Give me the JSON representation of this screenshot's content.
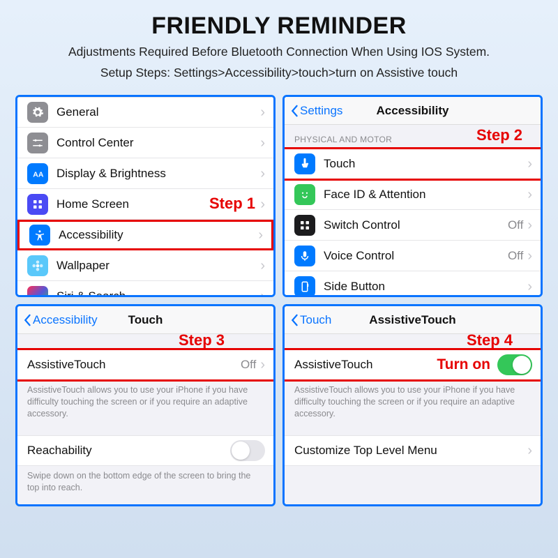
{
  "header": {
    "title": "FRIENDLY REMINDER",
    "line1": "Adjustments Required Before Bluetooth Connection When Using IOS System.",
    "line2": "Setup Steps: Settings>Accessibility>touch>turn on Assistive touch"
  },
  "steps": {
    "s1": "Step 1",
    "s2": "Step 2",
    "s3": "Step 3",
    "s4": "Step 4",
    "turnon": "Turn on"
  },
  "panel1": {
    "rows": [
      {
        "label": "General"
      },
      {
        "label": "Control Center"
      },
      {
        "label": "Display & Brightness"
      },
      {
        "label": "Home Screen"
      },
      {
        "label": "Accessibility"
      },
      {
        "label": "Wallpaper"
      },
      {
        "label": "Siri & Search"
      }
    ]
  },
  "panel2": {
    "back": "Settings",
    "title": "Accessibility",
    "section": "PHYSICAL AND MOTOR",
    "rows": [
      {
        "label": "Touch"
      },
      {
        "label": "Face ID & Attention"
      },
      {
        "label": "Switch Control",
        "val": "Off"
      },
      {
        "label": "Voice Control",
        "val": "Off"
      },
      {
        "label": "Side Button"
      }
    ]
  },
  "panel3": {
    "back": "Accessibility",
    "title": "Touch",
    "row1": {
      "label": "AssistiveTouch",
      "val": "Off"
    },
    "desc1": "AssistiveTouch allows you to use your iPhone if you have difficulty touching the screen or if you require an adaptive accessory.",
    "row2": {
      "label": "Reachability"
    },
    "desc2": "Swipe down on the bottom edge of the screen to bring the top into reach."
  },
  "panel4": {
    "back": "Touch",
    "title": "AssistiveTouch",
    "row1": {
      "label": "AssistiveTouch"
    },
    "desc1": "AssistiveTouch allows you to use your iPhone if you have difficulty touching the screen or if you require an adaptive accessory.",
    "row2": {
      "label": "Customize Top Level Menu"
    }
  }
}
